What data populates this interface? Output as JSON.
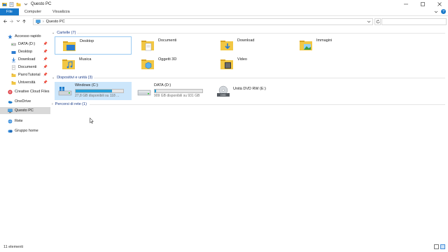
{
  "window": {
    "title": "Questo PC"
  },
  "ribbon": {
    "tabs": [
      {
        "label": "File"
      },
      {
        "label": "Computer"
      },
      {
        "label": "Visualizza"
      }
    ],
    "help_label": "?"
  },
  "address": {
    "path": "Questo PC"
  },
  "search": {
    "placeholder": ""
  },
  "sidebar": {
    "items": [
      {
        "label": "Accesso rapido",
        "icon": "star-icon"
      },
      {
        "label": "DATA (D:)",
        "icon": "drive-icon",
        "pinned": true
      },
      {
        "label": "Desktop",
        "icon": "folder-icon",
        "pinned": true
      },
      {
        "label": "Download",
        "icon": "download-icon",
        "pinned": true
      },
      {
        "label": "Documenti",
        "icon": "folder-icon",
        "pinned": true
      },
      {
        "label": "ParroTutorial",
        "icon": "folder-icon",
        "pinned": true
      },
      {
        "label": "Università",
        "icon": "folder-icon",
        "pinned": true
      },
      {
        "label": "Creative Cloud Files",
        "icon": "creative-cloud-icon"
      },
      {
        "label": "OneDrive",
        "icon": "onedrive-icon"
      },
      {
        "label": "Questo PC",
        "icon": "computer-icon",
        "selected": true
      },
      {
        "label": "Rete",
        "icon": "network-icon"
      },
      {
        "label": "Gruppo home",
        "icon": "homegroup-icon"
      }
    ]
  },
  "groups": {
    "folders": {
      "header": "Cartelle (7)",
      "items": [
        {
          "label": "Desktop",
          "icon": "desktop-folder-icon"
        },
        {
          "label": "Documenti",
          "icon": "documents-folder-icon"
        },
        {
          "label": "Download",
          "icon": "download-folder-icon"
        },
        {
          "label": "Immagini",
          "icon": "pictures-folder-icon"
        },
        {
          "label": "Musica",
          "icon": "music-folder-icon"
        },
        {
          "label": "Oggetti 3D",
          "icon": "3d-objects-folder-icon"
        },
        {
          "label": "Video",
          "icon": "video-folder-icon"
        }
      ]
    },
    "devices": {
      "header": "Dispositivi e unità (3)",
      "items": [
        {
          "label": "Windows (C:)",
          "icon": "windows-drive-icon",
          "space": "27,8 GB disponibili su 118 ...",
          "used_fraction": 0.77,
          "bar_color": "#26a0da"
        },
        {
          "label": "DATA (D:)",
          "icon": "hdd-icon",
          "space": "909 GB disponibili su 931 GB",
          "used_fraction": 0.03,
          "bar_color": "#26a0da"
        },
        {
          "label": "Unità DVD RW (E:)",
          "icon": "dvd-drive-icon"
        }
      ]
    },
    "network": {
      "header": "Percorsi di rete (1)"
    }
  },
  "status": {
    "count": "11 elementi"
  },
  "colors": {
    "accent": "#1979ca",
    "selection": "#cce6fb",
    "header_text": "#1e3f8a"
  }
}
